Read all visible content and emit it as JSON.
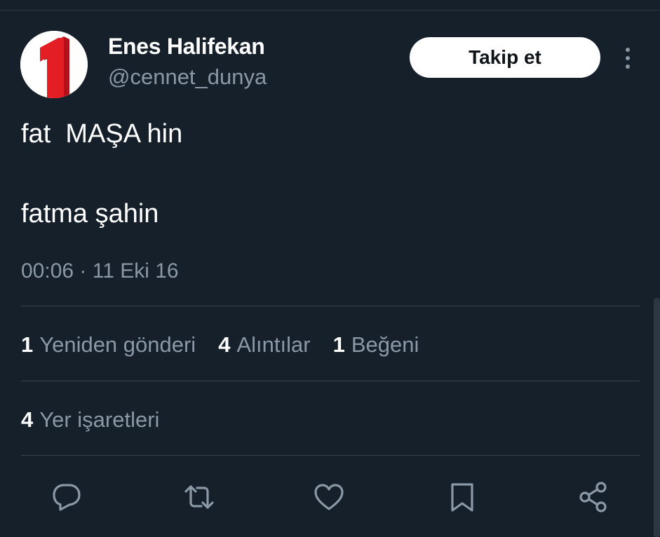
{
  "author": {
    "display_name": "Enes Halifekan",
    "handle": "@cennet_dunya",
    "avatar_text": "1"
  },
  "follow_label": "Takip et",
  "tweet": {
    "line1": "fat  MAŞA hin",
    "line2": "fatma şahin"
  },
  "timestamp": "00:06 · 11 Eki 16",
  "stats": {
    "retweets": {
      "count": "1",
      "label": "Yeniden gönderi"
    },
    "quotes": {
      "count": "4",
      "label": "Alıntılar"
    },
    "likes": {
      "count": "1",
      "label": "Beğeni"
    },
    "bookmarks": {
      "count": "4",
      "label": "Yer işaretleri"
    }
  },
  "actions": [
    "reply-icon",
    "retweet-icon",
    "like-icon",
    "bookmark-icon",
    "share-icon"
  ],
  "colors": {
    "background": "#15202b",
    "text_primary": "#ffffff",
    "text_secondary": "#8b98a5",
    "divider": "#38444d",
    "avatar_red": "#e31e24"
  }
}
